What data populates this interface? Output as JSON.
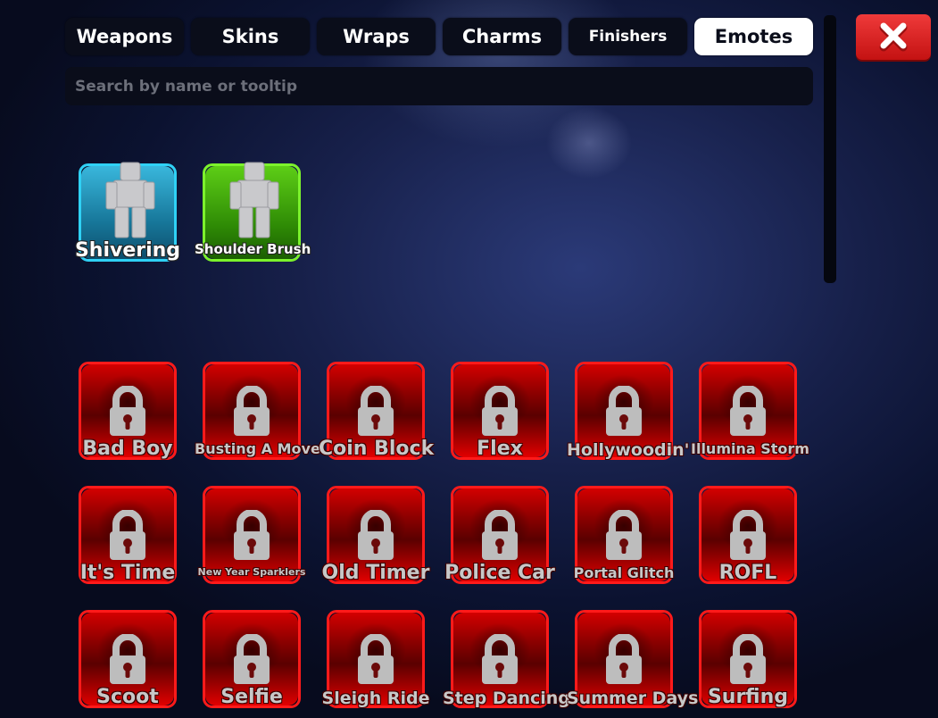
{
  "tabs": [
    {
      "label": "Weapons",
      "active": false
    },
    {
      "label": "Skins",
      "active": false
    },
    {
      "label": "Wraps",
      "active": false
    },
    {
      "label": "Charms",
      "active": false
    },
    {
      "label": "Finishers",
      "active": false
    },
    {
      "label": "Emotes",
      "active": true
    }
  ],
  "search": {
    "placeholder": "Search by name or tooltip",
    "value": ""
  },
  "close_button": {
    "icon": "close-x-icon",
    "color": "#e02828"
  },
  "owned": [
    {
      "name": "Shivering",
      "rarity_color": "#2fd1f5"
    },
    {
      "name": "Shoulder Brush",
      "rarity_color": "#7cf22c"
    }
  ],
  "locked": [
    {
      "name": "Bad Boy"
    },
    {
      "name": "Busting A Move"
    },
    {
      "name": "Coin Block"
    },
    {
      "name": "Flex"
    },
    {
      "name": "Hollywoodin'"
    },
    {
      "name": "Illumina Storm"
    },
    {
      "name": "It's Time"
    },
    {
      "name": "New Year Sparklers"
    },
    {
      "name": "Old Timer"
    },
    {
      "name": "Police Car"
    },
    {
      "name": "Portal Glitch"
    },
    {
      "name": "ROFL"
    },
    {
      "name": "Scoot"
    },
    {
      "name": "Selfie"
    },
    {
      "name": "Sleigh Ride"
    },
    {
      "name": "Step Dancing"
    },
    {
      "name": "Summer Days"
    },
    {
      "name": "Surfing"
    }
  ],
  "lock_icon": "padlock-icon",
  "locked_color": "#ff1a1a"
}
